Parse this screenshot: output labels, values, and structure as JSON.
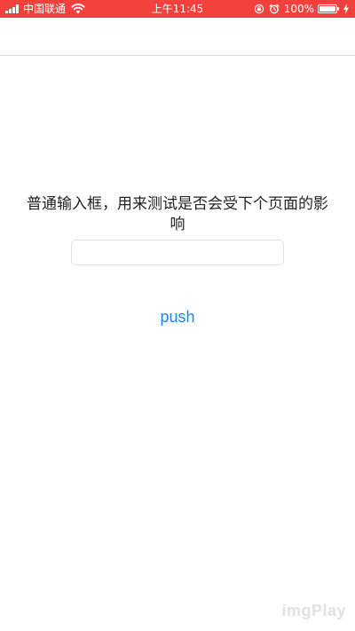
{
  "status_bar": {
    "carrier": "中国联通",
    "time": "上午11:45",
    "battery_percent": "100%",
    "battery_level": 1.0,
    "background_color": "#f2413d",
    "icons": [
      "signal-icon",
      "wifi-icon",
      "rotation-lock-icon",
      "alarm-icon",
      "battery-icon",
      "charging-icon"
    ]
  },
  "content": {
    "label": "普通输入框，用来测试是否会受下个页面的影响",
    "input_value": "",
    "input_placeholder": "",
    "push_label": "push",
    "push_color": "#1a87e8"
  },
  "watermark": {
    "text": "imgPlay"
  }
}
